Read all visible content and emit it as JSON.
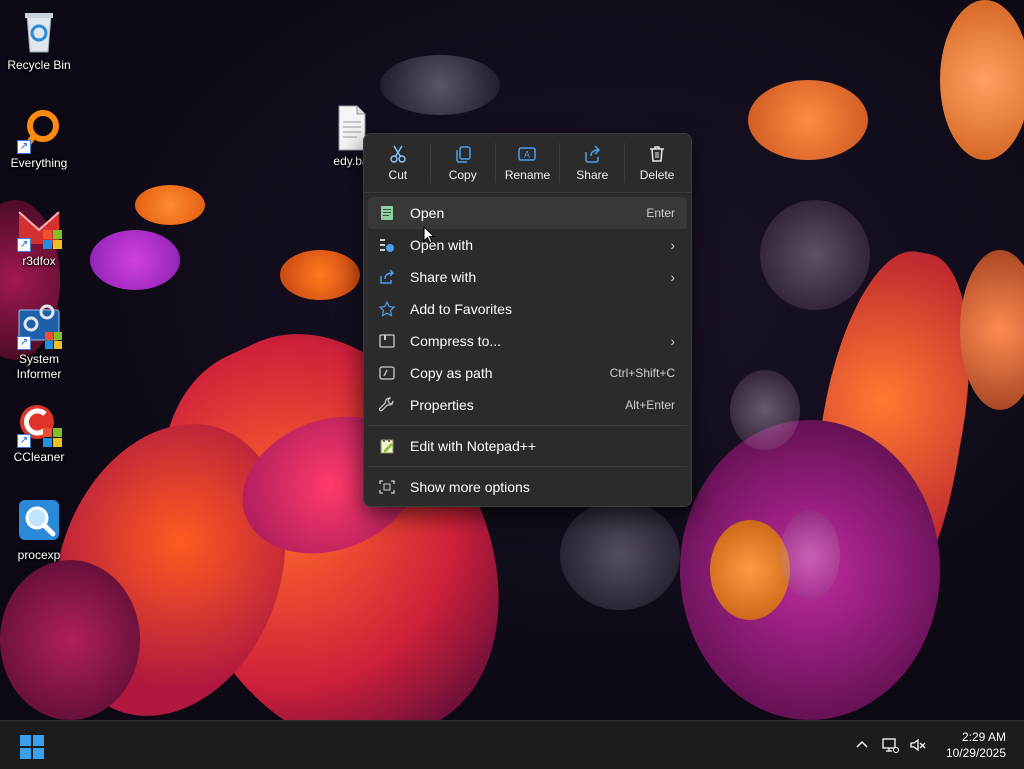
{
  "desktop": {
    "icons": [
      {
        "label": "Recycle Bin",
        "icon": "recycle-bin-icon"
      },
      {
        "label": "Everything",
        "icon": "everything-search-icon"
      },
      {
        "label": "r3dfox",
        "icon": "r3dfox-browser-icon"
      },
      {
        "label": "System Informer",
        "icon": "system-informer-icon"
      },
      {
        "label": "CCleaner",
        "icon": "ccleaner-icon"
      },
      {
        "label": "procexp",
        "icon": "process-explorer-icon"
      }
    ],
    "selected_file": {
      "label": "edy.ba",
      "icon": "text-file-icon"
    }
  },
  "context_menu": {
    "toolbar": [
      {
        "label": "Cut",
        "icon": "scissors-icon"
      },
      {
        "label": "Copy",
        "icon": "copy-icon"
      },
      {
        "label": "Rename",
        "icon": "rename-icon"
      },
      {
        "label": "Share",
        "icon": "share-icon"
      },
      {
        "label": "Delete",
        "icon": "trash-icon"
      }
    ],
    "items": [
      {
        "label": "Open",
        "shortcut": "Enter",
        "icon": "notepad-icon"
      },
      {
        "label": "Open with",
        "shortcut": "",
        "icon": "open-with-icon",
        "submenu": "›"
      },
      {
        "label": "Share with",
        "shortcut": "",
        "icon": "share-with-icon",
        "submenu": "›"
      },
      {
        "label": "Add to Favorites",
        "shortcut": "",
        "icon": "star-icon"
      },
      {
        "label": "Compress to...",
        "shortcut": "",
        "icon": "archive-icon",
        "submenu": "›"
      },
      {
        "label": "Copy as path",
        "shortcut": "Ctrl+Shift+C",
        "icon": "copy-path-icon"
      },
      {
        "label": "Properties",
        "shortcut": "Alt+Enter",
        "icon": "wrench-icon"
      }
    ],
    "extra_items": [
      {
        "label": "Edit with Notepad++",
        "icon": "notepad-plus-plus-icon"
      }
    ],
    "more": {
      "label": "Show more options",
      "icon": "show-more-icon"
    }
  },
  "taskbar": {
    "start_icon": "windows-start-icon",
    "tray": {
      "chevron": "^",
      "time": "2:29 AM",
      "date": "10/29/2025"
    }
  },
  "colors": {
    "menu_bg": "#2b2b2b",
    "accent": "#4ca0f0",
    "taskbar_bg": "#1c1c1c"
  }
}
